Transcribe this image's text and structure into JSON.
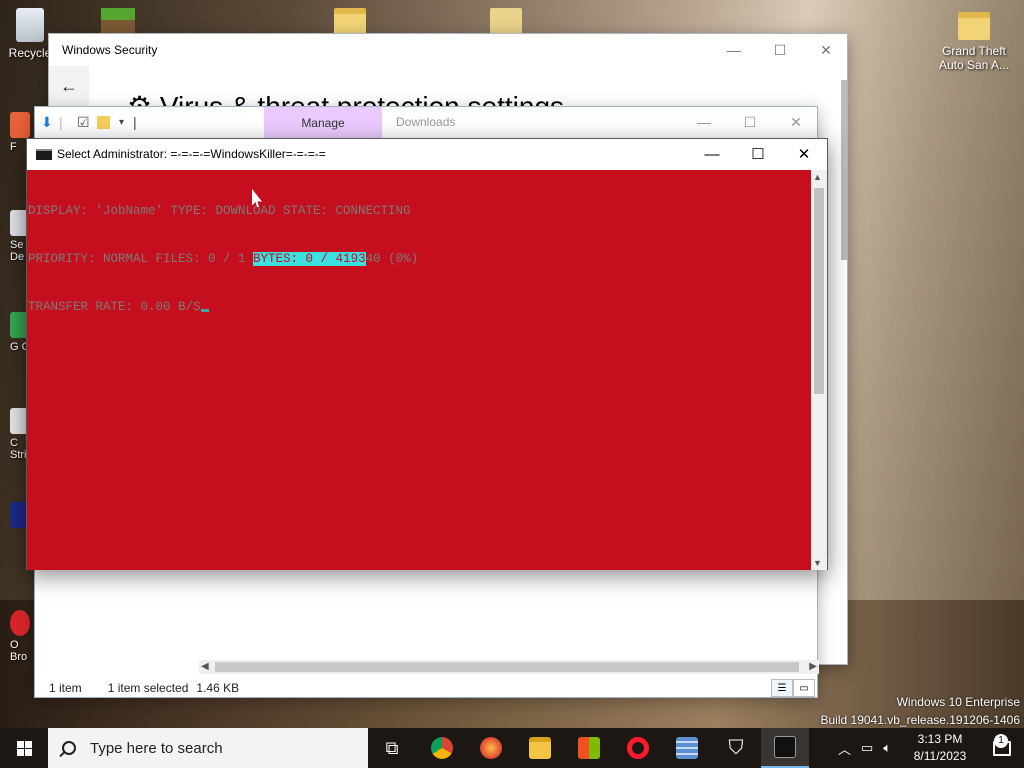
{
  "desktop": {
    "icons": [
      {
        "label": "Recycle"
      },
      {
        "label": ""
      },
      {
        "label": ""
      },
      {
        "label": ""
      },
      {
        "label": "Grand Theft Auto San A..."
      }
    ],
    "side_labels": [
      "F",
      "Se De",
      "G C",
      "C Stri",
      "",
      "O Bro"
    ],
    "watermark_line1": "Windows 10 Enterprise",
    "watermark_line2": "Build 19041.vb_release.191206-1406"
  },
  "windows_security": {
    "title": "Windows Security",
    "heading": "Virus & threat protection settings",
    "back_glyph": "←",
    "minimize": "—",
    "maximize": "☐",
    "close": "✕"
  },
  "explorer": {
    "manage_tab": "Manage",
    "downloads_label": "Downloads",
    "status_items": "1 item",
    "status_selected": "1 item selected",
    "status_size": "1.46 KB",
    "minimize": "—",
    "maximize": "☐",
    "close": "✕"
  },
  "console": {
    "title": "Select Administrator:  =-=-=-=WindowsKiller=-=-=-=",
    "line1": "DISPLAY: 'JobName' TYPE: DOWNLOAD STATE: CONNECTING",
    "line2_pre": "PRIORITY: NORMAL FILES: 0 / 1 ",
    "line2_sel": "BYTES: 0 / 4193",
    "line2_post": "40 (0%)",
    "line3": "TRANSFER RATE: 0.00 B/S",
    "minimize": "—",
    "maximize": "☐",
    "close": "✕",
    "colors": {
      "background": "#c50f1f",
      "text": "#7a7a7a",
      "selection": "#3be0e0"
    }
  },
  "taskbar": {
    "search_placeholder": "Type here to search",
    "apps": [
      {
        "icon": "task-view-icon"
      },
      {
        "icon": "chrome-icon"
      },
      {
        "icon": "firefox-icon"
      },
      {
        "icon": "file-explorer-icon"
      },
      {
        "icon": "store-icon"
      },
      {
        "icon": "opera-icon"
      },
      {
        "icon": "calculator-icon"
      },
      {
        "icon": "windows-security-icon"
      },
      {
        "icon": "command-prompt-icon"
      }
    ],
    "time": "3:13 PM",
    "date": "8/11/2023",
    "notification_count": "1"
  }
}
